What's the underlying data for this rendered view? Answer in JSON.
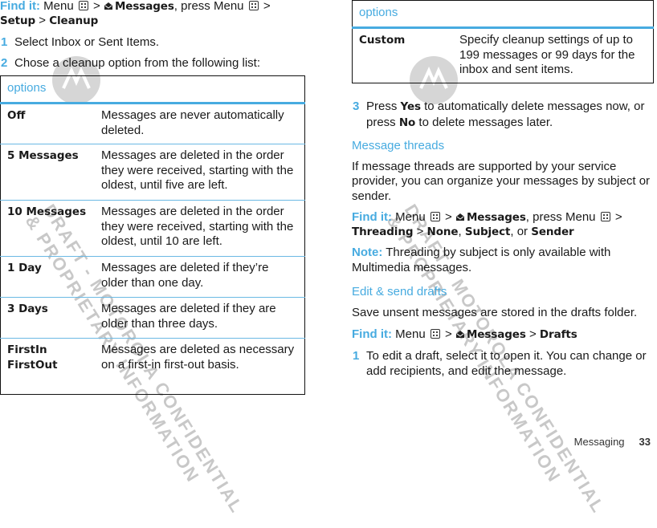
{
  "left": {
    "find_it": {
      "label": "Find it:",
      "menu": "Menu",
      "sep": ">",
      "messages": "Messages",
      "press_menu": ", press Menu",
      "setup": "Setup",
      "cleanup": "Cleanup"
    },
    "steps": [
      {
        "num": "1",
        "text": "Select Inbox or Sent Items."
      },
      {
        "num": "2",
        "text": "Chose a cleanup option from the following list:"
      }
    ],
    "table": {
      "header": "options",
      "rows": [
        {
          "term": "Off",
          "desc": "Messages are never automatically deleted."
        },
        {
          "term": "5 Messages",
          "desc": "Messages are deleted in the order they were received, starting with the oldest, until five are left."
        },
        {
          "term": "10 Messages",
          "desc": "Messages are deleted in the order they were received, starting with the oldest, until 10 are left."
        },
        {
          "term": "1 Day",
          "desc": "Messages are deleted if they’re older than one day."
        },
        {
          "term": "3 Days",
          "desc": "Messages are deleted if they are older than three days."
        },
        {
          "term": "FirstIn FirstOut",
          "desc": "Messages are deleted as necessary on a first-in first-out basis."
        }
      ]
    }
  },
  "right": {
    "table": {
      "header": "options",
      "rows": [
        {
          "term": "Custom",
          "desc": "Specify cleanup settings of up to 199 messages or 99 days for the inbox and sent items."
        }
      ]
    },
    "step3": {
      "num": "3",
      "pre": "Press ",
      "yes": "Yes",
      "mid": " to automatically delete messages now, or press ",
      "no": "No",
      "post": " to delete messages later."
    },
    "threads": {
      "heading": "Message threads",
      "body": "If message threads are supported by your service provider, you can organize your messages by subject or sender.",
      "find_label": "Find it:",
      "menu": "Menu",
      "messages": "Messages",
      "press_menu": ", press Menu",
      "threading": "Threading",
      "none": "None",
      "subject": "Subject",
      "or": ", or ",
      "sender": "Sender",
      "note_label": "Note:",
      "note_text": " Threading by subject is only available with Multimedia messages."
    },
    "drafts": {
      "heading": "Edit & send drafts",
      "body": "Save unsent messages are stored in the drafts folder.",
      "find_label": "Find it:",
      "menu": "Menu",
      "messages": "Messages",
      "drafts": "Drafts",
      "step_num": "1",
      "step_text": "To edit a draft, select it to open it. You can change or add recipients, and edit the message."
    }
  },
  "footer": {
    "section": "Messaging",
    "page": "33"
  },
  "watermark": {
    "line1": "DRAFT - MOTOROLA CONFIDENTIAL",
    "line2": "& PROPRIETARY INFORMATION"
  },
  "colors": {
    "accent": "#47abe0",
    "text": "#1a1a1a",
    "watermark": "#c8c8c8"
  }
}
